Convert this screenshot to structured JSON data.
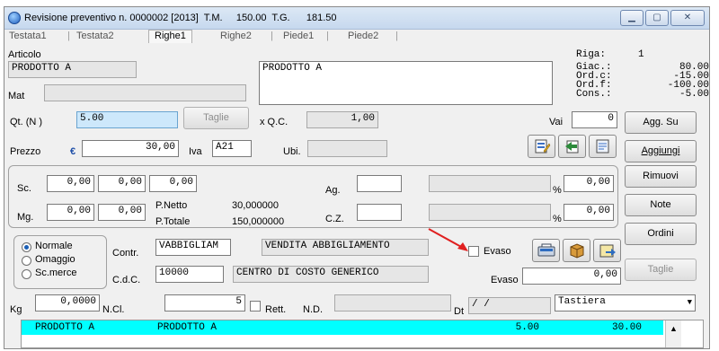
{
  "window": {
    "title": "Revisione preventivo n. 0000002 [2013]  T.M.     150.00  T.G.      181.50",
    "minimize": "▁",
    "maximize": "▢",
    "close": "✕"
  },
  "tabs": [
    {
      "label": "Testata1"
    },
    {
      "label": "Testata2"
    },
    {
      "label": "Righe1"
    },
    {
      "label": "Righe2"
    },
    {
      "label": "Piede1"
    },
    {
      "label": "Piede2"
    }
  ],
  "articolo": {
    "label": "Articolo",
    "code": "PRODOTTO A",
    "description": "PRODOTTO A",
    "mat_label": "Mat",
    "mat_value": ""
  },
  "riga": {
    "label": "Riga:",
    "value": "1",
    "giac_label": "Giac.:",
    "giac_value": "80.00",
    "ordc_label": "Ord.c:",
    "ordc_value": "-15.00",
    "ordf_label": "Ord.f:",
    "ordf_value": "-100.00",
    "cons_label": "Cons.:",
    "cons_value": "-5.00"
  },
  "qta": {
    "label": "Qt.  (N )",
    "value": "5.00",
    "taglie_label": "Taglie",
    "qc_label": "x  Q.C.",
    "qc_value": "1,00",
    "vai_label": "Vai",
    "vai_value": "0"
  },
  "prezzo": {
    "label": "Prezzo",
    "currency": "€",
    "value": "30,00",
    "iva_label": "Iva",
    "iva_value": "A21",
    "ubi_label": "Ubi.",
    "ubi_value": ""
  },
  "sconti": {
    "sc_label": "Sc.",
    "sc_values": [
      "0,00",
      "0,00",
      "0,00"
    ],
    "mg_label": "Mg.",
    "mg_values": [
      "0,00",
      "0,00"
    ],
    "pnetto_label": "P.Netto",
    "pnetto_value": "30,000000",
    "ptotale_label": "P.Totale",
    "ptotale_value": "150,000000",
    "ag_label": "Ag.",
    "ag_value": "",
    "ag_desc": "",
    "ag_pct": "0,00",
    "cz_label": "C.Z.",
    "cz_value": "",
    "cz_desc": "",
    "cz_pct": "0,00",
    "pct_sign": "%"
  },
  "tipo": {
    "options": [
      "Normale",
      "Omaggio",
      "Sc.merce"
    ],
    "selected": "Normale"
  },
  "contr": {
    "label": "Contr.",
    "code": "VABBIGLIAM",
    "desc": "VENDITA ABBIGLIAMENTO",
    "cdc_label": "C.d.C.",
    "cdc_code": "10000",
    "cdc_desc": "CENTRO DI COSTO GENERICO",
    "evaso_chk_label": "Evaso",
    "evaso_label": "Evaso",
    "evaso_value": "0,00"
  },
  "bottom": {
    "kg_label": "Kg",
    "kg_value": "0,0000",
    "ncl_label": "N.Cl.",
    "ncl_value": "5",
    "rett_label": "Rett.",
    "nd_label": "N.D.",
    "nd_value": "",
    "dt_label": "Dt",
    "dt_value": " /  /",
    "input_mode": "Tastiera"
  },
  "buttons": {
    "agg_su": "Agg. Su",
    "aggiungi": "Aggiungi",
    "rimuovi": "Rimuovi",
    "note": "Note",
    "ordini": "Ordini",
    "taglie": "Taglie"
  },
  "grid": {
    "rows": [
      {
        "code": "PRODOTTO A",
        "desc": "PRODOTTO A",
        "qty": "5.00",
        "price": "30.00"
      }
    ]
  },
  "colors": {
    "grid_row": "#00ffff",
    "arrow": "#e02020",
    "qty_field": "#cde8fb"
  }
}
